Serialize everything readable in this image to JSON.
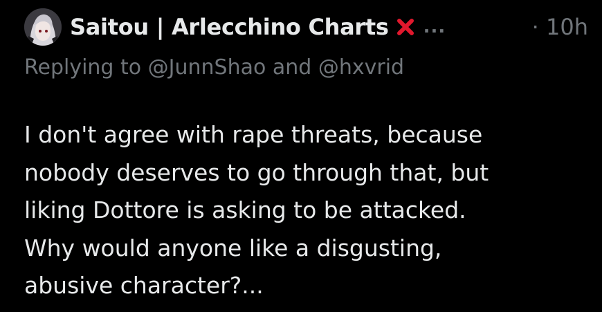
{
  "post": {
    "author_name": "Saitou | Arlecchino Charts",
    "author_badge_icon": "cross-mark-icon",
    "more_label": "...",
    "time_label": "· 10h",
    "reply_text": "Replying to @JunnShao and @hxvrid",
    "body_text": "I don't agree with rape threats, because\nnobody deserves to go through that, but\nliking Dottore is asking to be attacked.\nWhy would anyone like a disgusting,\nabusive character?..."
  },
  "colors": {
    "background": "#000000",
    "text": "#e7e9ea",
    "muted": "#71767b",
    "cross": "#e0182d"
  }
}
